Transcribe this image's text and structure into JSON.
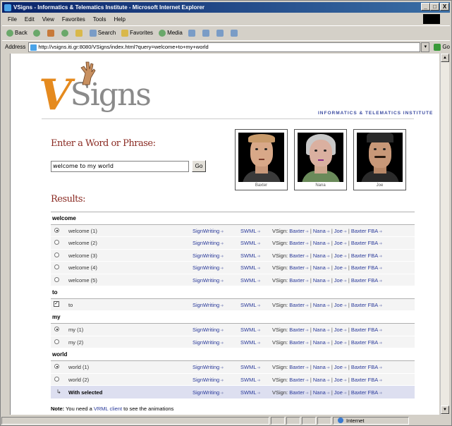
{
  "window": {
    "title": "VSigns - Informatics & Telematics Institute - Microsoft Internet Explorer",
    "controls": [
      "_",
      "□",
      "X"
    ]
  },
  "menu": [
    "File",
    "Edit",
    "View",
    "Favorites",
    "Tools",
    "Help"
  ],
  "toolbar": {
    "back": "Back",
    "search": "Search",
    "favorites": "Favorites",
    "media": "Media"
  },
  "address": {
    "label": "Address",
    "url": "http://vsigns.iti.gr:8080/VSigns/index.html?query=welcome+to+my+world",
    "go": "Go"
  },
  "page": {
    "logo_text": "Signs",
    "logo_letter": "V",
    "institute": "INFORMATICS & TELEMATICS INSTITUTE",
    "enter_heading": "Enter a Word or Phrase:",
    "query_value": "welcome to my world",
    "go_label": "Go",
    "results_heading": "Results:",
    "avatars": [
      {
        "name": "Baxter"
      },
      {
        "name": "Nana"
      },
      {
        "name": "Joe"
      }
    ],
    "link_labels": {
      "signwriting": "SignWriting",
      "swml": "SWML",
      "vsign": "VSign:",
      "baxter": "Baxter",
      "nana": "Nana",
      "joe": "Joe",
      "baxter_fba": "Baxter FBA",
      "sep": "|",
      "arrow": "➜"
    },
    "groups": [
      {
        "word": "welcome",
        "rows": [
          {
            "label": "welcome (1)",
            "selected": true
          },
          {
            "label": "welcome (2)",
            "selected": false
          },
          {
            "label": "welcome (3)",
            "selected": false
          },
          {
            "label": "welcome (4)",
            "selected": false
          },
          {
            "label": "welcome (5)",
            "selected": false
          }
        ]
      },
      {
        "word": "to",
        "checkbox": true,
        "rows": [
          {
            "label": "to",
            "selected": true
          }
        ]
      },
      {
        "word": "my",
        "rows": [
          {
            "label": "my (1)",
            "selected": true
          },
          {
            "label": "my (2)",
            "selected": false
          }
        ]
      },
      {
        "word": "world",
        "rows": [
          {
            "label": "world (1)",
            "selected": true
          },
          {
            "label": "world (2)",
            "selected": false
          }
        ]
      }
    ],
    "footer_row": {
      "tick": "↳",
      "label": "With selected"
    },
    "note": {
      "prefix": "Note:",
      "before": " You need a ",
      "link": "VRML client",
      "after": " to see the animations"
    }
  },
  "status": {
    "zone": "Internet"
  },
  "colors": {
    "heading": "#8a2a22",
    "link": "#2a3a9a",
    "logo_v": "#e58a1e"
  }
}
